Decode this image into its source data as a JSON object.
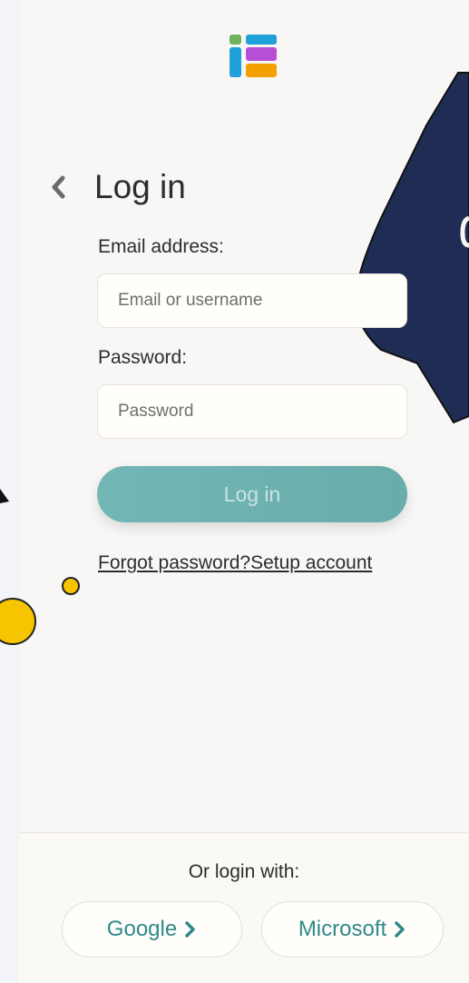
{
  "header": {
    "logo_icon": "ie-logo-icon",
    "back_icon": "chevron-left-icon",
    "title": "Log in"
  },
  "form": {
    "email_label": "Email address:",
    "email_placeholder": "Email or username",
    "email_value": "",
    "password_label": "Password:",
    "password_placeholder": "Password",
    "password_value": "",
    "submit_label": "Log in"
  },
  "links": {
    "forgot_password": "Forgot password?",
    "setup_account": "Setup account"
  },
  "footer": {
    "prompt": "Or login with:",
    "google_label": "Google",
    "microsoft_label": "Microsoft",
    "chevron_icon": "chevron-right-icon"
  },
  "colors": {
    "accent": "#2f8a88",
    "button_fill": "#6fb3b2",
    "callout_navy": "#1f2d55",
    "dot_yellow": "#f7c400",
    "logo_green": "#6fb35c",
    "logo_blue": "#1fa0d8",
    "logo_purple": "#b64fd6",
    "logo_orange": "#f4a000"
  }
}
